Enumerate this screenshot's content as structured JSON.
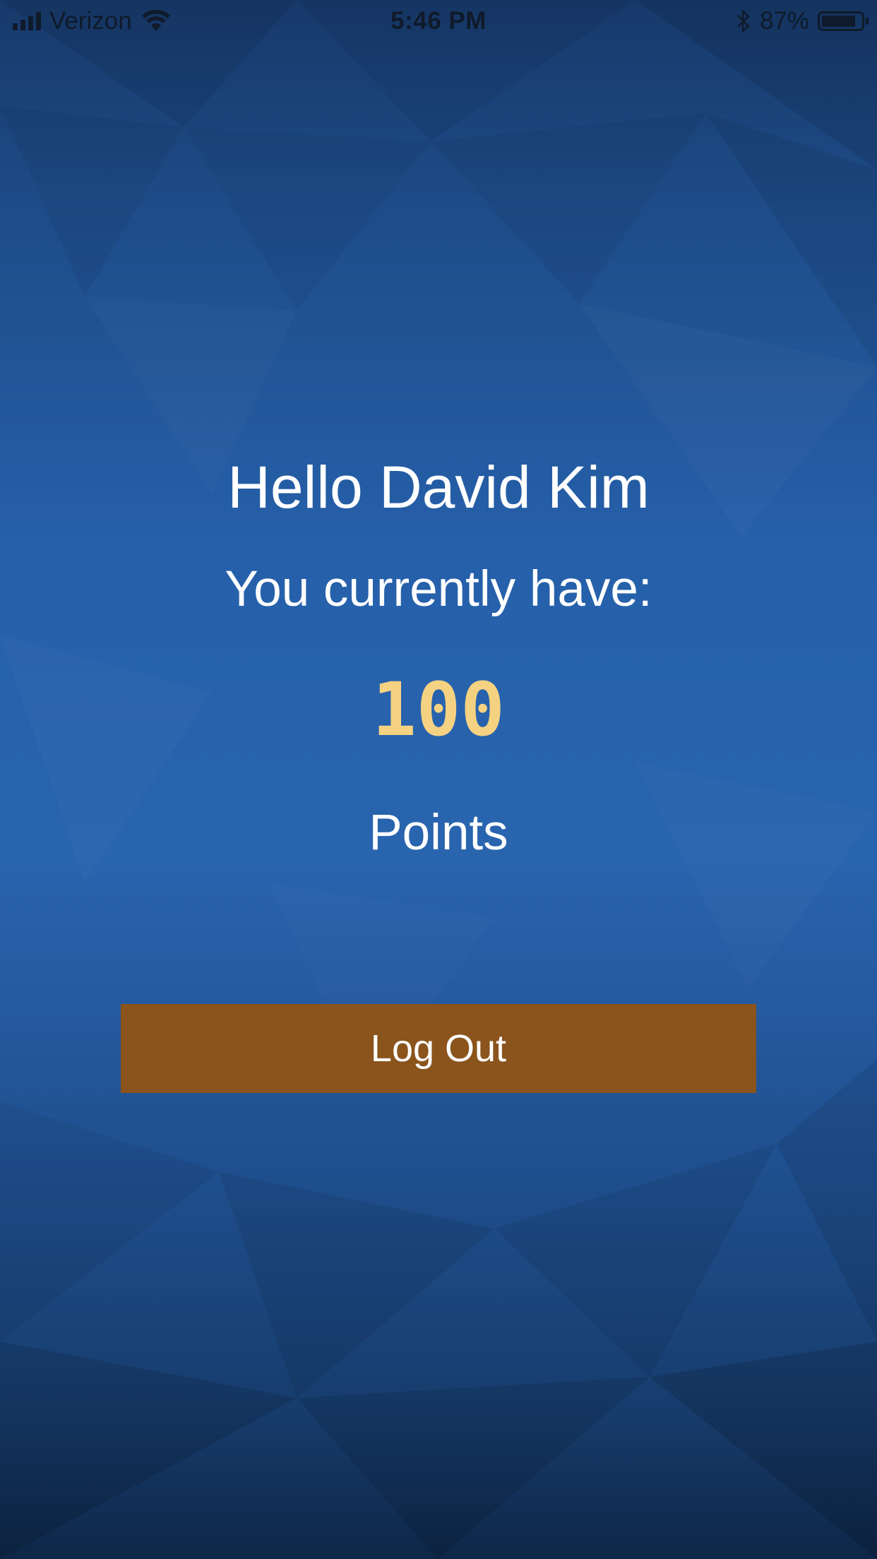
{
  "status_bar": {
    "carrier": "Verizon",
    "time": "5:46 PM",
    "battery_percent": "87%",
    "battery_level": 0.87,
    "icons": [
      "signal-bars-icon",
      "wifi-icon",
      "bluetooth-icon",
      "battery-icon"
    ]
  },
  "main": {
    "greeting": "Hello David Kim",
    "subtitle": "You currently have:",
    "points_value": "100",
    "points_label": "Points",
    "logout_label": "Log Out"
  },
  "colors": {
    "background": "#235a9f",
    "background_dark": "#0f2a4f",
    "points": "#f5d282",
    "button": "#8a541c",
    "text": "#ffffff"
  }
}
